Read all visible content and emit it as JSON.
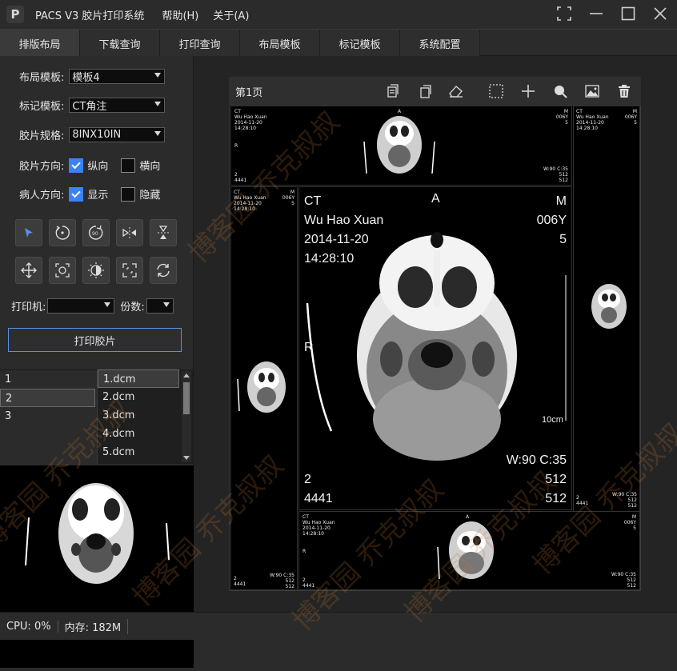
{
  "app": {
    "logo_letter": "P",
    "title": "PACS V3 胶片打印系统",
    "menu": [
      "帮助(H)",
      "关于(A)"
    ]
  },
  "tabs": [
    "排版布局",
    "下载查询",
    "打印查询",
    "布局模板",
    "标记模板",
    "系统配置"
  ],
  "settings": {
    "layout_label": "布局模板:",
    "layout_value": "模板4",
    "mark_label": "标记模板:",
    "mark_value": "CT角注",
    "film_label": "胶片规格:",
    "film_value": "8INX10IN",
    "orient_label": "胶片方向:",
    "orient_portrait": "纵向",
    "orient_landscape": "横向",
    "patient_label": "病人方向:",
    "patient_show": "显示",
    "patient_hide": "隐藏"
  },
  "tools": [
    "select-arrow-icon",
    "rotate-left-icon",
    "rotate-90-icon",
    "flip-horizontal-icon",
    "flip-vertical-icon",
    "move-icon",
    "zoom-fit-icon",
    "window-level-icon",
    "fullscreen-icon",
    "reset-icon"
  ],
  "printer": {
    "printer_label": "打印机:",
    "copies_label": "份数:",
    "print_button": "打印胶片"
  },
  "series_list": [
    "1",
    "2",
    "3"
  ],
  "file_list": [
    "1.dcm",
    "2.dcm",
    "3.dcm",
    "4.dcm",
    "5.dcm"
  ],
  "page": {
    "label": "第1页"
  },
  "overlay": {
    "modality": "CT",
    "orientation_top": "A",
    "sex": "M",
    "patient_name": "Wu Hao Xuan",
    "age": "006Y",
    "date": "2014-11-20",
    "series_no": "5",
    "time": "14:28:10",
    "side": "R",
    "scale": "10cm",
    "wl": "W:90 C:35",
    "image_no": "2",
    "matrix_x": "512",
    "study_id": "4441",
    "matrix_y": "512"
  },
  "status": {
    "cpu": "CPU: 0%",
    "memory": "内存: 182M"
  },
  "watermark": "博客园 乔克叔叔"
}
